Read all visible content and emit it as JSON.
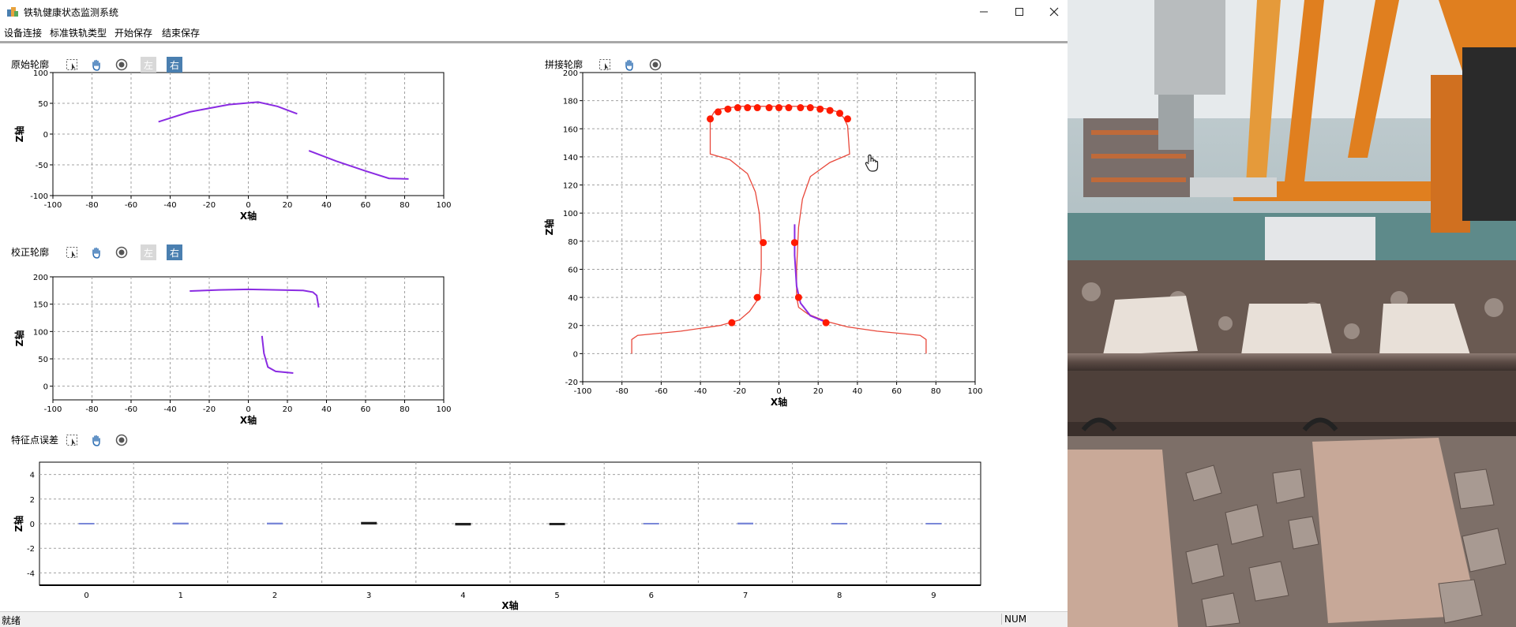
{
  "window": {
    "title": "铁轨健康状态监测系统"
  },
  "menu": [
    {
      "label": "设备连接",
      "name": "menu-device-connect"
    },
    {
      "label": "标准铁轨类型",
      "name": "menu-standard-rail-type"
    },
    {
      "label": "开始保存",
      "name": "menu-start-save"
    },
    {
      "label": "结束保存",
      "name": "menu-end-save"
    }
  ],
  "panels": {
    "original": {
      "title": "原始轮廓",
      "tool_left": "左",
      "tool_right": "右"
    },
    "corrected": {
      "title": "校正轮廓",
      "tool_left": "左",
      "tool_right": "右"
    },
    "stitched": {
      "title": "拼接轮廓"
    },
    "error": {
      "title": "特征点误差"
    }
  },
  "status": {
    "ready": "就绪",
    "num": "NUM"
  },
  "colors": {
    "profile": "#8a2be2",
    "rail": "#e8483b",
    "point": "#ff1a00",
    "grid": "#a0a0a0"
  },
  "chart_data": [
    {
      "id": "original",
      "type": "line",
      "xlabel": "X轴",
      "ylabel": "Z轴",
      "xlim": [
        -100,
        100
      ],
      "ylim": [
        -100,
        100
      ],
      "xticks": [
        -100,
        -80,
        -60,
        -40,
        -20,
        0,
        20,
        40,
        60,
        80,
        100
      ],
      "yticks": [
        -100,
        -50,
        0,
        50,
        100
      ],
      "grid": true,
      "series": [
        {
          "x": [
            -46,
            -30,
            -10,
            5,
            15,
            25
          ],
          "y": [
            20,
            36,
            48,
            52,
            45,
            33
          ]
        },
        {
          "x": [
            31,
            45,
            60,
            72,
            82
          ],
          "y": [
            -27,
            -44,
            -60,
            -72,
            -73
          ]
        }
      ]
    },
    {
      "id": "corrected",
      "type": "line",
      "xlabel": "X轴",
      "ylabel": "Z轴",
      "xlim": [
        -100,
        100
      ],
      "ylim": [
        -25,
        200
      ],
      "xticks": [
        -100,
        -80,
        -60,
        -40,
        -20,
        0,
        20,
        40,
        60,
        80,
        100
      ],
      "yticks": [
        0,
        50,
        100,
        150,
        200
      ],
      "grid": true,
      "series": [
        {
          "x": [
            -30,
            -15,
            0,
            15,
            28,
            33,
            35,
            36
          ],
          "y": [
            174,
            176,
            177,
            176,
            175,
            172,
            166,
            144
          ]
        },
        {
          "x": [
            7,
            8,
            10,
            14,
            23
          ],
          "y": [
            92,
            60,
            35,
            27,
            24
          ]
        }
      ]
    },
    {
      "id": "stitched",
      "type": "line",
      "xlabel": "X轴",
      "ylabel": "Z轴",
      "xlim": [
        -100,
        100
      ],
      "ylim": [
        -20,
        200
      ],
      "xticks": [
        -100,
        -80,
        -60,
        -40,
        -20,
        0,
        20,
        40,
        60,
        80,
        100
      ],
      "yticks": [
        -20,
        0,
        20,
        40,
        60,
        80,
        100,
        120,
        140,
        160,
        180,
        200
      ],
      "grid": true,
      "profile": {
        "x": [
          -75,
          -75,
          -72,
          -50,
          -30,
          -20,
          -15,
          -10,
          -9,
          -9,
          -10,
          -12,
          -16,
          -25,
          -35,
          -35,
          -33,
          -30,
          -25,
          -20,
          -15,
          -10,
          -5,
          0,
          5,
          10,
          15,
          20,
          25,
          30,
          33,
          35,
          36,
          26,
          16,
          12,
          10,
          9,
          9,
          10,
          15,
          24,
          35,
          50,
          72,
          75,
          75
        ],
        "y": [
          0,
          10,
          13,
          16,
          20,
          24,
          30,
          40,
          60,
          80,
          100,
          115,
          128,
          138,
          142,
          167,
          172,
          174,
          175,
          176,
          176,
          176,
          176,
          176,
          176,
          176,
          176,
          175,
          174,
          172,
          168,
          162,
          142,
          136,
          126,
          110,
          90,
          60,
          40,
          33,
          28,
          23,
          19,
          16,
          13,
          10,
          0
        ]
      },
      "measured": {
        "x": [
          8,
          8,
          9,
          11,
          16,
          23
        ],
        "y": [
          92,
          70,
          48,
          36,
          27,
          23
        ]
      },
      "feature_points": {
        "x": [
          -35,
          -31,
          -26,
          -21,
          -16,
          -11,
          -5,
          0,
          5,
          11,
          16,
          21,
          26,
          31,
          35,
          -8,
          -11,
          -24,
          8,
          10,
          24
        ],
        "y": [
          167,
          172,
          174,
          175,
          175,
          175,
          175,
          175,
          175,
          175,
          175,
          174,
          173,
          171,
          167,
          79,
          40,
          22,
          79,
          40,
          22
        ]
      }
    },
    {
      "id": "error",
      "type": "bar",
      "xlabel": "X轴",
      "ylabel": "Z轴",
      "ylim": [
        -5,
        5
      ],
      "yticks": [
        -4,
        -2,
        0,
        2,
        4
      ],
      "categories": [
        "0",
        "1",
        "2",
        "3",
        "4",
        "5",
        "6",
        "7",
        "8",
        "9"
      ],
      "grid": true,
      "values": [
        0,
        0.02,
        0.02,
        0.08,
        -0.08,
        -0.06,
        0,
        0.02,
        0,
        0
      ]
    }
  ]
}
